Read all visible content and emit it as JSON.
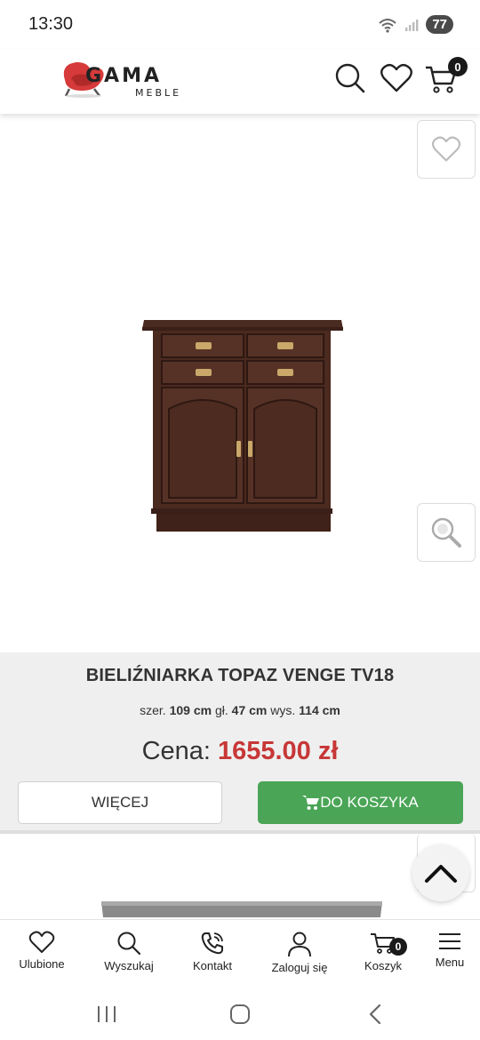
{
  "status_bar": {
    "time": "13:30",
    "battery": "77"
  },
  "header": {
    "logo_text": "GAMA",
    "logo_subtext": "MEBLE",
    "icons": [
      "search-icon",
      "heart-icon",
      "cart-icon"
    ],
    "cart_count": "0"
  },
  "product": {
    "title": "BIELIŹNIARKA TOPAZ VENGE TV18",
    "dims": {
      "width_label": "szer.",
      "width_value": "109 cm",
      "depth_label": "gł.",
      "depth_value": "47 cm",
      "height_label": "wys.",
      "height_value": "114 cm"
    },
    "price_label": "Cena:",
    "price_value": "1655.00 zł",
    "more_button": "WIĘCEJ",
    "cart_button": "DO KOSZYKA"
  },
  "bottom_nav": {
    "items": [
      {
        "label": "Ulubione",
        "icon": "heart-icon"
      },
      {
        "label": "Wyszukaj",
        "icon": "search-icon"
      },
      {
        "label": "Kontakt",
        "icon": "phone-icon"
      },
      {
        "label": "Zaloguj się",
        "icon": "user-icon"
      },
      {
        "label": "Koszyk",
        "icon": "cart-icon",
        "badge": "0"
      },
      {
        "label": "Menu",
        "icon": "menu-icon"
      }
    ]
  },
  "colors": {
    "accent_green": "#4aa556",
    "price_red": "#c73737",
    "panel_gray": "#efefef",
    "logo_red": "#d63a3a"
  }
}
